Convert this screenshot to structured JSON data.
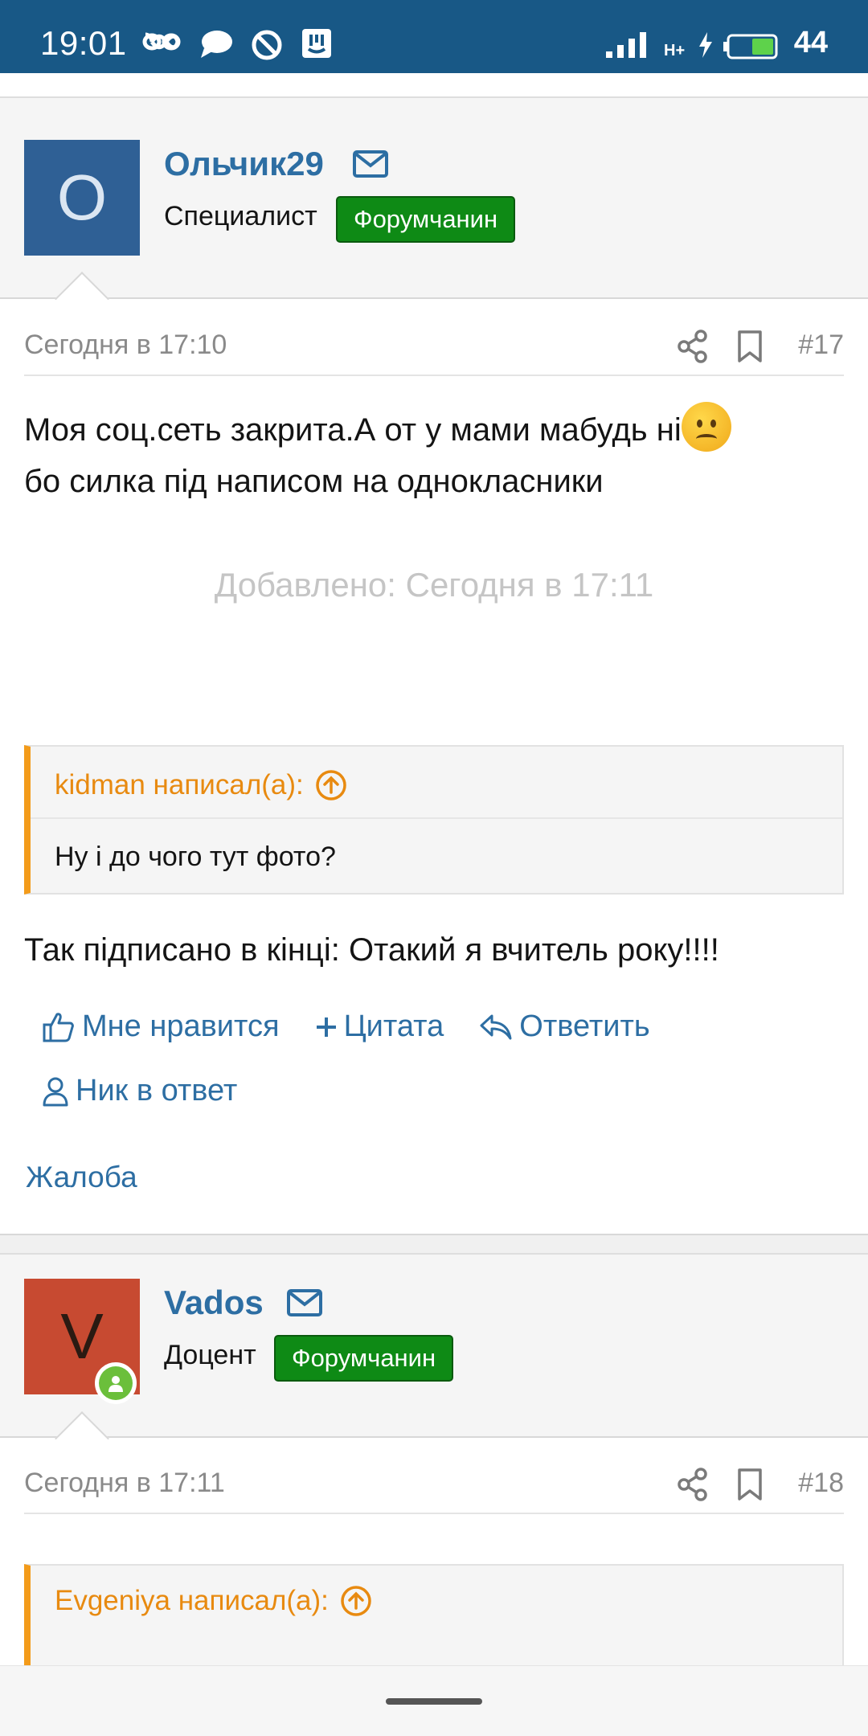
{
  "status_bar": {
    "time": "19:01",
    "battery": "44",
    "network": "H+",
    "icons": [
      "infinity-icon",
      "chat-bubble-icon",
      "do-not-disturb-icon",
      "app-notification-icon",
      "signal-icon",
      "charging-icon",
      "battery-icon"
    ]
  },
  "posts": [
    {
      "avatar_letter": "O",
      "avatar_color": "#2f6095",
      "username": "Ольчик29",
      "user_title": "Специалист",
      "badge": "Форумчанин",
      "date": "Сегодня в 17:10",
      "number": "#17",
      "text_line1": "Моя соц.сеть закрита.А от у мами мабудь ні",
      "text_line2": "бо силка під написом на однокласники",
      "added": "Добавлено: Сегодня в 17:11",
      "quote_author": "kidman написал(а):",
      "quote_text": "Ну і до чого тут фото?",
      "reply_text": "Так підписано в кінці: Отакий я вчитель року!!!!",
      "actions": {
        "like": "Мне нравится",
        "quote": "Цитата",
        "reply": "Ответить",
        "nick": "Ник в ответ"
      },
      "report": "Жалоба"
    },
    {
      "avatar_letter": "V",
      "avatar_color": "#c74a31",
      "username": "Vados",
      "user_title": "Доцент",
      "badge": "Форумчанин",
      "date": "Сегодня в 17:11",
      "number": "#18",
      "quote_author": "Evgeniya написал(а):"
    }
  ],
  "colors": {
    "status_bar": "#185886",
    "link": "#2d6ea3",
    "badge": "#0e8a15",
    "quote_accent": "#f39b1a"
  }
}
